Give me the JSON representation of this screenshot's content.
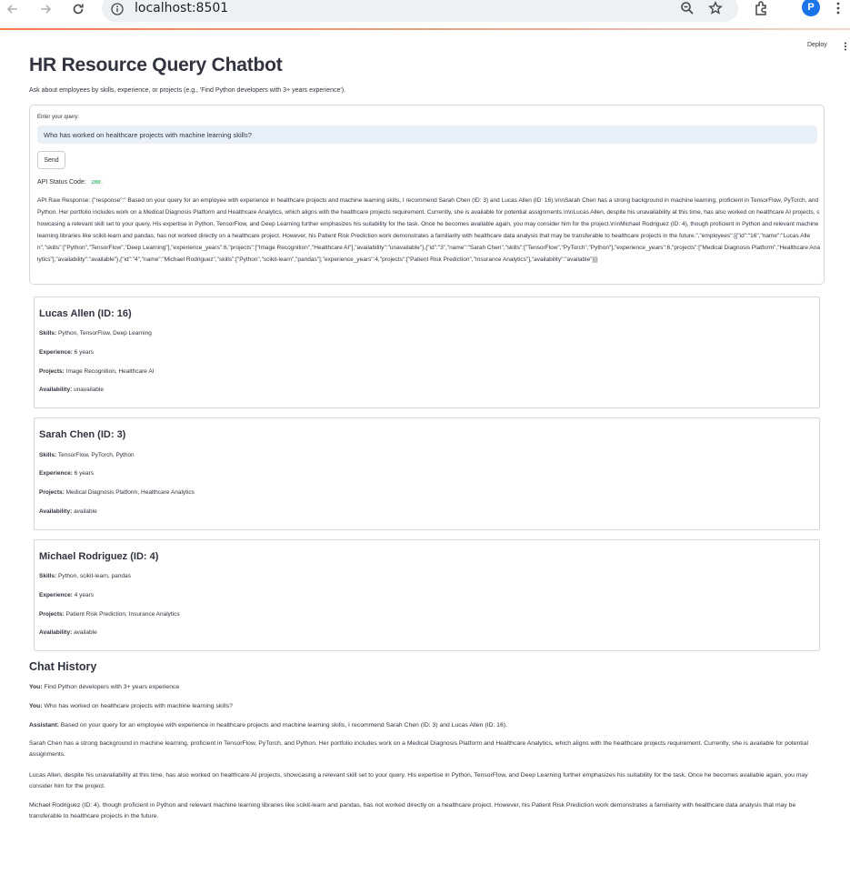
{
  "browser": {
    "url": "localhost:8501",
    "profile_initial": "P"
  },
  "header": {
    "deploy_label": "Deploy"
  },
  "page": {
    "title": "HR Resource Query Chatbot",
    "subtitle": "Ask about employees by skills, experience, or projects (e.g., 'Find Python developers with 3+ years experience')."
  },
  "query_form": {
    "label": "Enter your query:",
    "value": "Who has worked on healthcare projects with machine learning skills?",
    "send_label": "Send",
    "status_prefix": "API Status Code:",
    "status_code": "200",
    "raw_response": "API Raw Response: {\"response\":\" Based on your query for an employee with experience in healthcare projects and machine learning skills, I recommend Sarah Chen (ID: 3) and Lucas Allen (ID: 16).\\n\\nSarah Chen has a strong background in machine learning, proficient in TensorFlow, PyTorch, and Python. Her portfolio includes work on a Medical Diagnosis Platform and Healthcare Analytics, which aligns with the healthcare projects requirement. Currently, she is available for potential assignments.\\n\\nLucas Allen, despite his unavailability at this time, has also worked on healthcare AI projects, showcasing a relevant skill set to your query. His expertise in Python, TensorFlow, and Deep Learning further emphasizes his suitability for the task. Once he becomes available again, you may consider him for the project.\\n\\nMichael Rodriguez (ID: 4), though proficient in Python and relevant machine learning libraries like scikit-learn and pandas, has not worked directly on a healthcare project. However, his Patient Risk Prediction work demonstrates a familiarity with healthcare data analysis that may be transferable to healthcare projects in the future.\",\"employees\":[{\"id\":\"16\",\"name\":\"Lucas Allen\",\"skills\":[\"Python\",\"TensorFlow\",\"Deep Learning\"],\"experience_years\":6,\"projects\":[\"Image Recognition\",\"Healthcare AI\"],\"availability\":\"unavailable\"},{\"id\":\"3\",\"name\":\"Sarah Chen\",\"skills\":[\"TensorFlow\",\"PyTorch\",\"Python\"],\"experience_years\":6,\"projects\":[\"Medical Diagnosis Platform\",\"Healthcare Analytics\"],\"availability\":\"available\"},{\"id\":\"4\",\"name\":\"Michael Rodriguez\",\"skills\":[\"Python\",\"scikit-learn\",\"pandas\"],\"experience_years\":4,\"projects\":[\"Patient Risk Prediction\",\"Insurance Analytics\"],\"availability\":\"available\"}]}"
  },
  "labels": {
    "skills": "Skills:",
    "experience": "Experience:",
    "projects": "Projects:",
    "availability": "Availability:"
  },
  "employees": [
    {
      "heading": "Lucas Allen (ID: 16)",
      "skills": "Python, TensorFlow, Deep Learning",
      "experience": "6 years",
      "projects": "Image Recognition, Healthcare AI",
      "availability": "unavailable"
    },
    {
      "heading": "Sarah Chen (ID: 3)",
      "skills": "TensorFlow, PyTorch, Python",
      "experience": "6 years",
      "projects": "Medical Diagnosis Platform, Healthcare Analytics",
      "availability": "available"
    },
    {
      "heading": "Michael Rodriguez (ID: 4)",
      "skills": "Python, scikit-learn, pandas",
      "experience": "4 years",
      "projects": "Patient Risk Prediction, Insurance Analytics",
      "availability": "available"
    }
  ],
  "chat_history": {
    "title": "Chat History",
    "messages": [
      {
        "role": "You:",
        "text": "Find Python developers with 3+ years experience"
      },
      {
        "role": "You:",
        "text": "Who has worked on healthcare projects with machine learning skills?"
      },
      {
        "role": "Assistant:",
        "text": "Based on your query for an employee with experience in healthcare projects and machine learning skills, I recommend Sarah Chen (ID: 3) and Lucas Allen (ID: 16)."
      }
    ],
    "paragraphs": [
      "Sarah Chen has a strong background in machine learning, proficient in TensorFlow, PyTorch, and Python. Her portfolio includes work on a Medical Diagnosis Platform and Healthcare Analytics, which aligns with the healthcare projects requirement. Currently, she is available for potential assignments.",
      "Lucas Allen, despite his unavailability at this time, has also worked on healthcare AI projects, showcasing a relevant skill set to your query. His expertise in Python, TensorFlow, and Deep Learning further emphasizes his suitability for the task. Once he becomes available again, you may consider him for the project.",
      "Michael Rodriguez (ID: 4), though proficient in Python and relevant machine learning libraries like scikit-learn and pandas, has not worked directly on a healthcare project. However, his Patient Risk Prediction work demonstrates a familiarity with healthcare data analysis that may be transferable to healthcare projects in the future."
    ]
  }
}
